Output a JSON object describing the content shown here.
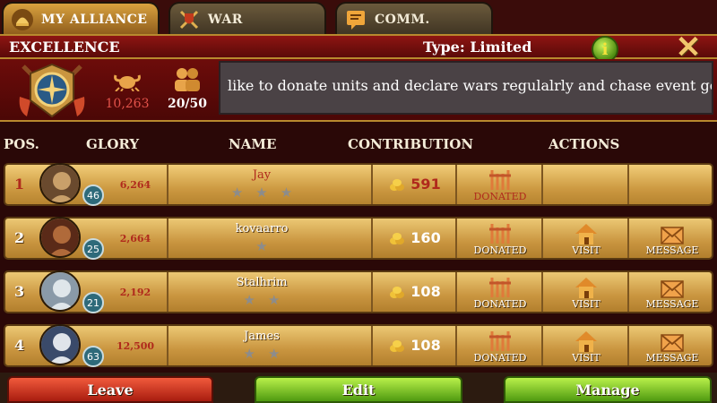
{
  "tabs": [
    {
      "label": "MY ALLIANCE",
      "icon": "alliance-helmet-icon"
    },
    {
      "label": "WAR",
      "icon": "war-shield-icon"
    },
    {
      "label": "COMM.",
      "icon": "chat-scroll-icon"
    }
  ],
  "header": {
    "alliance_name": "EXCELLENCE",
    "type_label": "Type: Limited",
    "info_label": "i",
    "close_label": "✕"
  },
  "alliance": {
    "glory": "10,263",
    "members": "20/50",
    "description": "like to donate units and declare wars regulalrly and chase event goals"
  },
  "columns": {
    "pos": "POS.",
    "glory": "GLORY",
    "name": "NAME",
    "contribution": "CONTRIBUTION",
    "actions": "ACTIONS"
  },
  "rows": [
    {
      "pos": "1",
      "level": "46",
      "glory": "6,264",
      "name": "Jay",
      "stars": 3,
      "contribution": "591",
      "actions": [
        "DONATED"
      ]
    },
    {
      "pos": "2",
      "level": "25",
      "glory": "2,664",
      "name": "kovaarro",
      "stars": 1,
      "contribution": "160",
      "actions": [
        "DONATED",
        "VISIT",
        "MESSAGE"
      ]
    },
    {
      "pos": "3",
      "level": "21",
      "glory": "2,192",
      "name": "Stalhrim",
      "stars": 2,
      "contribution": "108",
      "actions": [
        "DONATED",
        "VISIT",
        "MESSAGE"
      ]
    },
    {
      "pos": "4",
      "level": "63",
      "glory": "12,500",
      "name": "James",
      "stars": 2,
      "contribution": "108",
      "actions": [
        "DONATED",
        "VISIT",
        "MESSAGE"
      ]
    }
  ],
  "buttons": {
    "leave": "Leave",
    "edit": "Edit",
    "manage": "Manage"
  },
  "colors": {
    "accent_red": "#8e1512",
    "gold": "#c9953f",
    "button_green": "#4f9a10",
    "button_red": "#a81c0f"
  }
}
